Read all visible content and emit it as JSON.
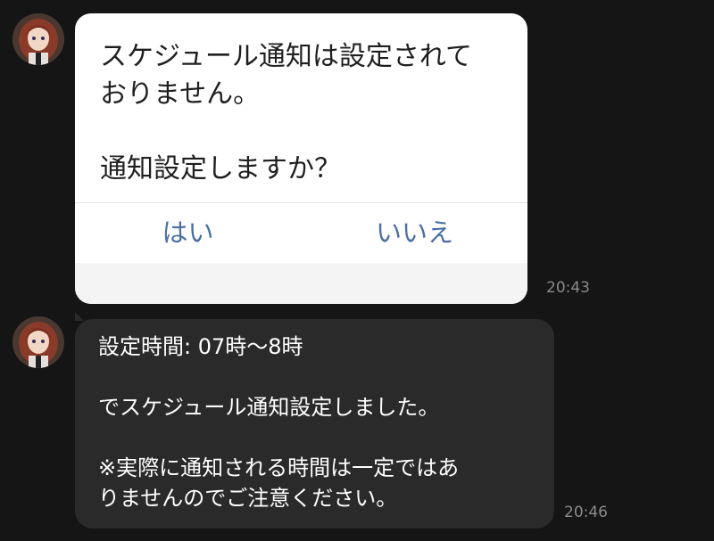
{
  "messages": [
    {
      "type": "confirm",
      "text": "スケジュール通知は設定されて\nおりません。\n\n通知設定しますか？",
      "buttons": {
        "yes": "はい",
        "no": "いいえ"
      },
      "time": "20:43"
    },
    {
      "type": "text",
      "text": "設定時間: 07時〜8時\n\nでスケジュール通知設定しました。\n\n※実際に通知される時間は一定ではあ\nりませんのでご注意ください。",
      "time": "20:46"
    }
  ],
  "colors": {
    "background": "#151515",
    "card": "#ffffff",
    "bubble": "#2a2a2a",
    "button_text": "#4a6fa3",
    "time_text": "#8a8a8a"
  },
  "icons": {
    "avatar": "avatar-icon"
  }
}
